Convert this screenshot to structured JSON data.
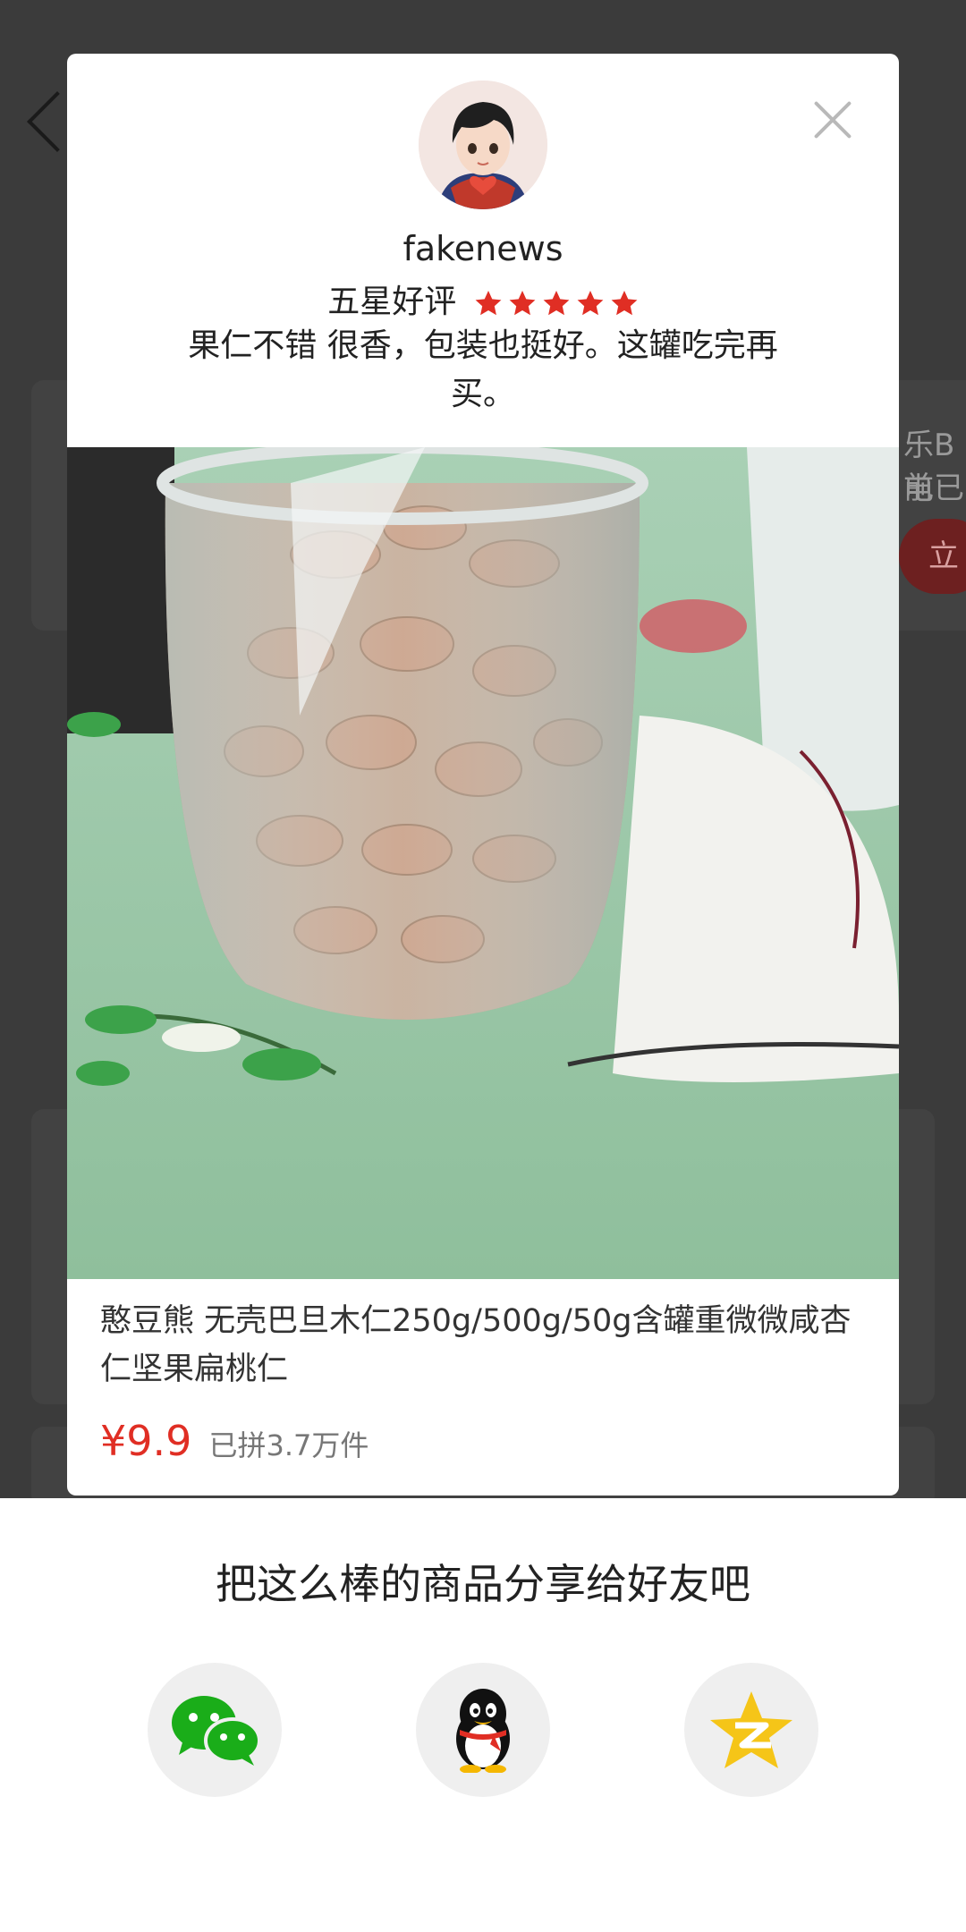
{
  "background": {
    "side_text_1": "乐B电",
    "side_text_2": "前已",
    "side_button": "立"
  },
  "review": {
    "username": "fakenews",
    "rating_label": "五星好评",
    "stars": 5,
    "text": "果仁不错 很香，包装也挺好。这罐吃完再买。"
  },
  "product": {
    "title": "憨豆熊 无壳巴旦木仁250g/500g/50g含罐重微微咸杏仁坚果扁桃仁",
    "price": "¥9.9",
    "sold": "已拼3.7万件"
  },
  "share": {
    "title": "把这么棒的商品分享给好友吧",
    "targets": [
      "wechat",
      "qq",
      "qzone"
    ]
  },
  "colors": {
    "price_red": "#e02e24",
    "star_red": "#e02e24",
    "wechat_green": "#1aad19",
    "qzone_yellow": "#f5c518"
  }
}
